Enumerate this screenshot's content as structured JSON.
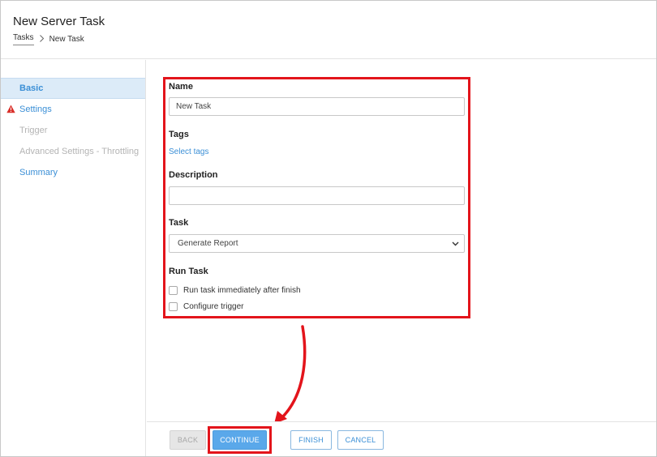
{
  "header": {
    "title": "New Server Task",
    "breadcrumb": [
      {
        "label": "Tasks"
      },
      {
        "label": "New Task"
      }
    ]
  },
  "sidebar": {
    "items": [
      {
        "label": "Basic",
        "state": "active"
      },
      {
        "label": "Settings",
        "state": "warning"
      },
      {
        "label": "Trigger",
        "state": "disabled"
      },
      {
        "label": "Advanced Settings - Throttling",
        "state": "disabled"
      },
      {
        "label": "Summary",
        "state": "link"
      }
    ]
  },
  "form": {
    "name": {
      "label": "Name",
      "value": "New Task"
    },
    "tags": {
      "label": "Tags",
      "link_label": "Select tags"
    },
    "description": {
      "label": "Description",
      "value": ""
    },
    "task": {
      "label": "Task",
      "selected": "Generate Report"
    },
    "run_task": {
      "label": "Run Task",
      "options": [
        {
          "label": "Run task immediately after finish",
          "checked": false
        },
        {
          "label": "Configure trigger",
          "checked": false
        }
      ]
    }
  },
  "footer": {
    "back_label": "BACK",
    "continue_label": "CONTINUE",
    "finish_label": "FINISH",
    "cancel_label": "CANCEL"
  },
  "colors": {
    "accent": "#3b8fd6",
    "primary_button": "#5aa8ea",
    "highlight": "#e3141b",
    "warning": "#d9302a",
    "active_bg": "#dcebf8"
  },
  "icons": {
    "breadcrumb_separator": "chevron-right-icon",
    "settings_warning": "warning-triangle-icon",
    "task_dropdown": "chevron-down-icon"
  }
}
